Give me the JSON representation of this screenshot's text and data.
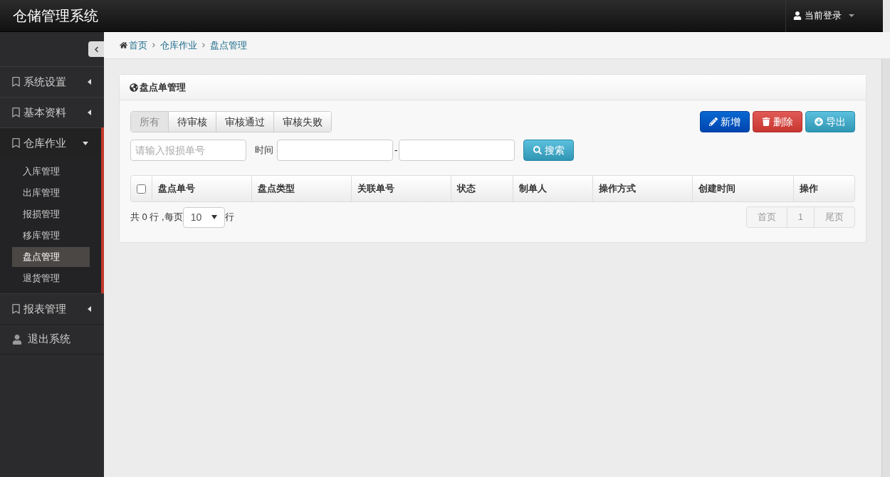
{
  "header": {
    "title": "仓储管理系统",
    "user_menu": "当前登录"
  },
  "sidebar": {
    "items": [
      {
        "kind": "menu",
        "label": "系统设置",
        "expanded": false
      },
      {
        "kind": "menu",
        "label": "基本资料",
        "expanded": false
      },
      {
        "kind": "menu",
        "label": "仓库作业",
        "expanded": true,
        "children": [
          {
            "label": "入库管理",
            "selected": false
          },
          {
            "label": "出库管理",
            "selected": false
          },
          {
            "label": "报损管理",
            "selected": false
          },
          {
            "label": "移库管理",
            "selected": false
          },
          {
            "label": "盘点管理",
            "selected": true
          },
          {
            "label": "退货管理",
            "selected": false
          }
        ]
      },
      {
        "kind": "menu",
        "label": "报表管理",
        "expanded": false
      },
      {
        "kind": "logout",
        "label": "退出系统"
      }
    ]
  },
  "breadcrumb": [
    "首页",
    "仓库作业",
    "盘点管理"
  ],
  "panel": {
    "title": "盘点单管理",
    "tabs": [
      {
        "label": "所有",
        "selected": true
      },
      {
        "label": "待审核",
        "selected": false
      },
      {
        "label": "审核通过",
        "selected": false
      },
      {
        "label": "审核失败",
        "selected": false
      }
    ],
    "actions": [
      {
        "kind": "add",
        "label": "新增"
      },
      {
        "kind": "delete",
        "label": "删除"
      },
      {
        "kind": "export",
        "label": "导出"
      }
    ],
    "search": {
      "placeholder": "请输入报损单号",
      "time_label": "时间",
      "range_separator": "-",
      "button": "搜索"
    },
    "table": {
      "select_all_checked": false,
      "columns": [
        "盘点单号",
        "盘点类型",
        "关联单号",
        "状态",
        "制单人",
        "操作方式",
        "创建时间",
        "操作"
      ]
    },
    "footer": {
      "total_prefix": "共 0 行 ,每页",
      "page_size": "10",
      "suffix": "行",
      "pagination": [
        "首页",
        "1",
        "尾页"
      ]
    }
  }
}
